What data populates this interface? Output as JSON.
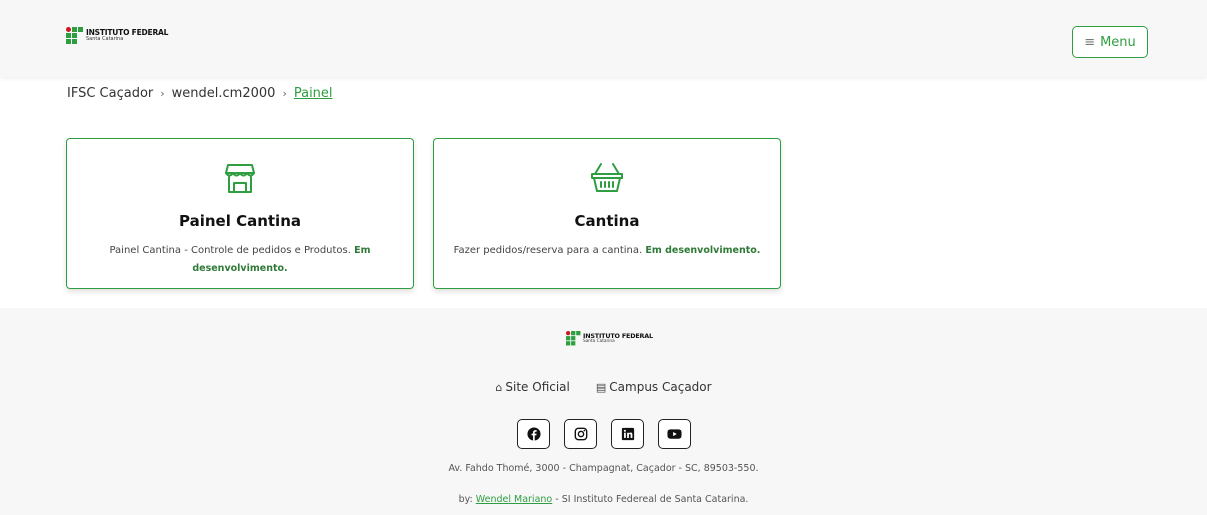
{
  "header": {
    "logo_line1": "INSTITUTO FEDERAL",
    "logo_line2": "Santa Catarina",
    "menu_label": "Menu"
  },
  "breadcrumb": {
    "items": [
      "IFSC Caçador",
      "wendel.cm2000",
      "Painel"
    ],
    "separator": ">"
  },
  "cards": [
    {
      "title": "Painel Cantina",
      "description": "Painel Cantina - Controle de pedidos e Produtos.",
      "status": "Em desenvolvimento.",
      "icon": "store-icon"
    },
    {
      "title": "Cantina",
      "description": "Fazer pedidos/reserva para a cantina.",
      "status": "Em desenvolvimento.",
      "icon": "basket-icon"
    }
  ],
  "footer": {
    "logo_line1": "INSTITUTO FEDERAL",
    "logo_line2": "Santa Catarina",
    "links": [
      {
        "label": "Site Oficial",
        "icon": "home-icon"
      },
      {
        "label": "Campus Caçador",
        "icon": "newspaper-icon"
      }
    ],
    "social": [
      "facebook-icon",
      "instagram-icon",
      "linkedin-icon",
      "youtube-icon"
    ],
    "address": "Av. Fahdo Thomé, 3000 - Champagnat, Caçador - SC, 89503-550.",
    "by_prefix": "by:",
    "author": "Wendel Mariano",
    "by_suffix": "- SI Instituto Federeal de Santa Catarina."
  },
  "colors": {
    "accent": "#2f9e41",
    "logo_red": "#cd191e",
    "header_bg": "#f7f7f7"
  }
}
